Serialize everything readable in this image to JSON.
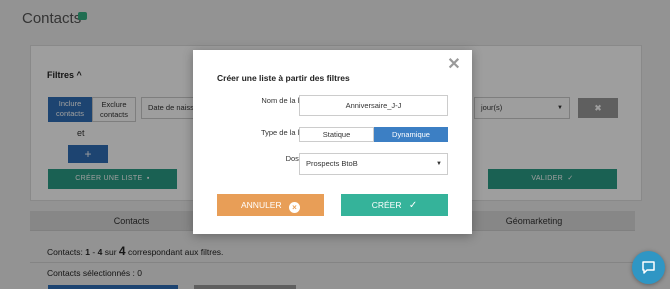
{
  "page": {
    "title": "Contacts",
    "title_badge": "",
    "filters_label": "Filtres",
    "filter": {
      "include_label": "Inclure contacts",
      "exclude_label": "Exclure contacts",
      "date_field": "Date de naiss",
      "days_field": "jour(s)",
      "remove_label": "✖",
      "joiner": "et",
      "add_label": "+"
    },
    "create_list_label": "CRÉER UNE LISTE",
    "validate_label": "VALIDER",
    "tabs": [
      {
        "label": "Contacts"
      },
      {
        "label": "Géomarketing"
      }
    ],
    "count": {
      "prefix": "Contacts:",
      "from": "1",
      "dash": "-",
      "to": "4",
      "sur": "sur",
      "total": "4",
      "suffix": "correspondant aux filtres."
    },
    "selected_text": "Contacts sélectionnés : 0"
  },
  "modal": {
    "title": "Créer une liste à partir des filtres",
    "close_icon": "close-icon",
    "name_label": "Nom de la liste",
    "name_value": "Anniversaire_J-J",
    "type_label": "Type de la liste",
    "type_options": [
      "Statique",
      "Dynamique"
    ],
    "type_selected": "Dynamique",
    "folder_label": "Dossier",
    "folder_value": "Prospects BtoB",
    "cancel_label": "ANNULER",
    "create_label": "CRÉER"
  },
  "colors": {
    "accent_blue": "#2f6fb6",
    "toggle_active": "#3c7fc4",
    "cancel": "#e89e57",
    "create": "#35b39a",
    "chat": "#2f96c4"
  }
}
